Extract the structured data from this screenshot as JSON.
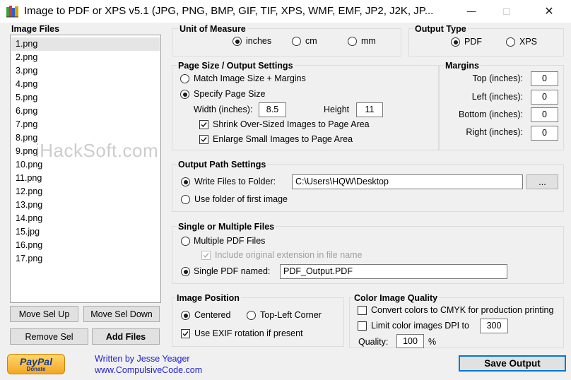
{
  "window": {
    "title": "Image to PDF or XPS  v5.1   (JPG, PNG, BMP, GIF, TIF, XPS, WMF, EMF, JP2, J2K, JP...",
    "minimize_label": "—",
    "maximize_label": "☐",
    "close_label": "✕"
  },
  "image_files": {
    "title": "Image Files",
    "items": [
      "1.png",
      "2.png",
      "3.png",
      "4.png",
      "5.png",
      "6.png",
      "7.png",
      "8.png",
      "9.png",
      "10.png",
      "11.png",
      "12.png",
      "13.png",
      "14.png",
      "15.jpg",
      "16.png",
      "17.png"
    ],
    "selected_index": 0,
    "move_up_label": "Move Sel Up",
    "move_down_label": "Move Sel Down",
    "remove_label": "Remove Sel",
    "add_label": "Add Files"
  },
  "unit_of_measure": {
    "title": "Unit of Measure",
    "options": [
      "inches",
      "cm",
      "mm"
    ],
    "selected": "inches"
  },
  "output_type": {
    "title": "Output Type",
    "options": [
      "PDF",
      "XPS"
    ],
    "selected": "PDF"
  },
  "page_size": {
    "title": "Page Size / Output Settings",
    "match_label": "Match Image Size + Margins",
    "specify_label": "Specify Page Size",
    "selected": "specify",
    "width_label": "Width (inches):",
    "width_value": "8.5",
    "height_label": "Height",
    "height_value": "11",
    "shrink_label": "Shrink Over-Sized Images to Page Area",
    "shrink_checked": true,
    "enlarge_label": "Enlarge Small Images to Page Area",
    "enlarge_checked": true
  },
  "margins": {
    "title": "Margins",
    "top_label": "Top (inches):",
    "top_value": "0",
    "left_label": "Left (inches):",
    "left_value": "0",
    "bottom_label": "Bottom (inches):",
    "bottom_value": "0",
    "right_label": "Right (inches):",
    "right_value": "0"
  },
  "output_path": {
    "title": "Output Path Settings",
    "write_label": "Write Files to Folder:",
    "folder_value": "C:\\Users\\HQW\\Desktop",
    "browse_label": "...",
    "first_image_label": "Use folder of first image",
    "selected": "write"
  },
  "single_multiple": {
    "title": "Single or Multiple Files",
    "multiple_label": "Multiple PDF Files",
    "include_ext_label": "Include original extension in file name",
    "include_ext_checked": true,
    "single_label": "Single PDF named:",
    "single_value": "PDF_Output.PDF",
    "selected": "single"
  },
  "image_position": {
    "title": "Image Position",
    "centered_label": "Centered",
    "top_left_label": "Top-Left Corner",
    "selected": "centered",
    "exif_label": "Use EXIF rotation if present",
    "exif_checked": true
  },
  "color_quality": {
    "title": "Color Image Quality",
    "cmyk_label": "Convert colors to CMYK for production printing",
    "cmyk_checked": false,
    "limit_dpi_label": "Limit color images DPI to",
    "limit_dpi_checked": false,
    "dpi_value": "300",
    "quality_label": "Quality:",
    "quality_value": "100",
    "percent_label": "%"
  },
  "footer": {
    "paypal_label": "PayPal",
    "paypal_sub": "Donate",
    "author_label": "Written by Jesse Yeager",
    "website_label": "www.CompulsiveCode.com",
    "save_label": "Save Output",
    "watermark": "iHackSoft.com"
  }
}
